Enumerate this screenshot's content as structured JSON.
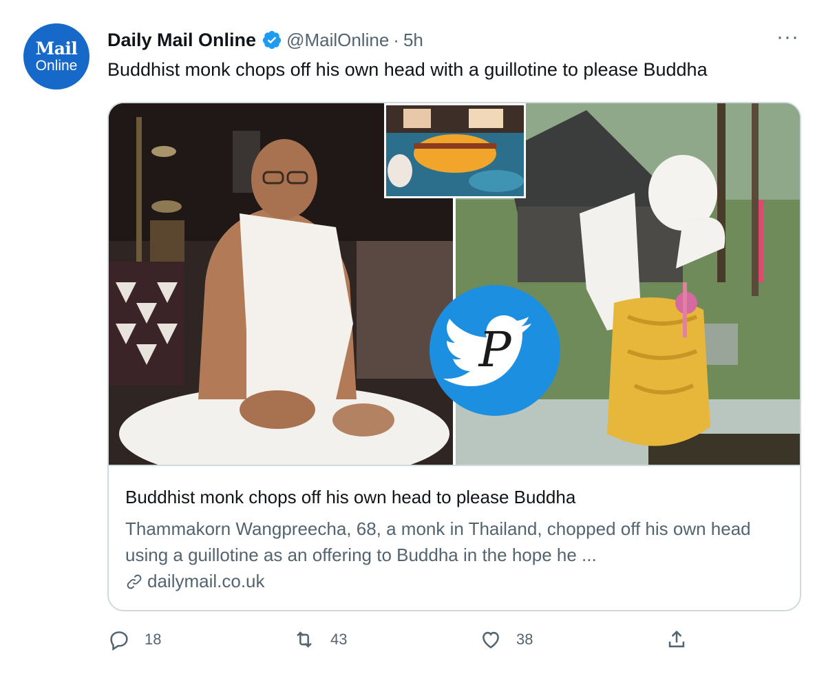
{
  "avatar": {
    "line1": "Mail",
    "line2": "Online"
  },
  "author": {
    "name": "Daily Mail Online",
    "handle": "@MailOnline",
    "separator": "·",
    "time": "5h"
  },
  "more_label": "···",
  "tweet_text": "Buddhist monk chops off his own head with a guillotine to please Buddha",
  "card": {
    "title": "Buddhist monk chops off his own head to please Buddha",
    "description": "Thammakorn Wangpreecha, 68, a monk in Thailand, chopped off his own head using a guillotine as an offering to Buddha in the hope he ...",
    "domain": "dailymail.co.uk"
  },
  "actions": {
    "reply_count": "18",
    "retweet_count": "43",
    "like_count": "38"
  },
  "watermark": {
    "letter": "P"
  },
  "colors": {
    "brand_blue": "#1769c9",
    "verified_blue": "#1d9bf0",
    "secondary_text": "#536471",
    "border": "#cfd9de"
  }
}
